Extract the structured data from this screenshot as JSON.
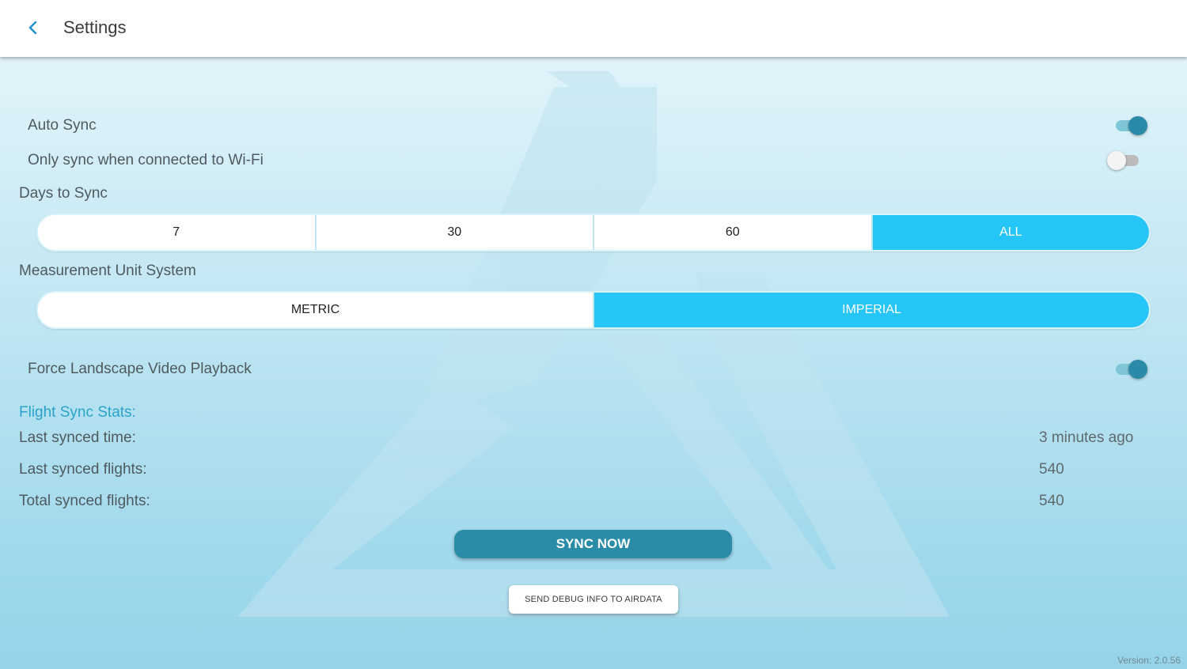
{
  "header": {
    "title": "Settings",
    "back_icon": "chevron-left-icon"
  },
  "colors": {
    "accent": "#25c5f7",
    "button": "#2b8ca8",
    "stats_title": "#2ba3c9",
    "toggle_on": "#2a8aa8"
  },
  "settings": {
    "auto_sync": {
      "label": "Auto Sync",
      "enabled": true
    },
    "wifi_only": {
      "label": "Only sync when connected to Wi-Fi",
      "enabled": false
    },
    "days_to_sync": {
      "label": "Days to Sync",
      "options": [
        "7",
        "30",
        "60",
        "ALL"
      ],
      "selected": "ALL"
    },
    "measurement_unit": {
      "label": "Measurement Unit System",
      "options": [
        "METRIC",
        "IMPERIAL"
      ],
      "selected": "IMPERIAL"
    },
    "force_landscape": {
      "label": "Force Landscape Video Playback",
      "enabled": true
    }
  },
  "stats": {
    "title": "Flight Sync Stats:",
    "last_synced_time": {
      "label": "Last synced time:",
      "value": "3 minutes ago"
    },
    "last_synced_flights": {
      "label": "Last synced flights:",
      "value": "540"
    },
    "total_synced_flights": {
      "label": "Total synced flights:",
      "value": "540"
    }
  },
  "actions": {
    "sync_now": "SYNC NOW",
    "send_debug": "SEND DEBUG INFO TO AIRDATA"
  },
  "footer": {
    "version": "Version: 2.0.56"
  }
}
